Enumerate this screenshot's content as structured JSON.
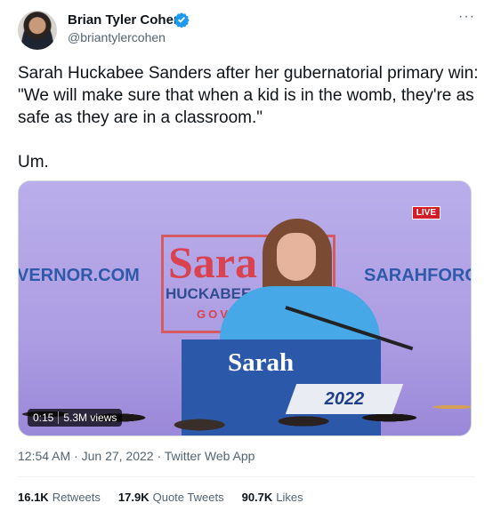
{
  "author": {
    "name": "Brian Tyler Cohen",
    "handle": "@briantylercohen",
    "verified_color": "#1d9bf0"
  },
  "icons": [
    "avatar",
    "verified-badge-icon",
    "more-options-icon"
  ],
  "more_label": "···",
  "tweet_text": "Sarah Huckabee Sanders after her gubernatorial primary win: \"We will make sure that when a kid is in the womb, they're as safe as they are in a classroom.\"\n\nUm.",
  "video": {
    "live_label": "LIVE",
    "duration": "0:15",
    "views": "5.3M views",
    "banner_left": "VERNOR.COM",
    "banner_right": "SARAHFORGO",
    "sign_name": "Sara",
    "sign_surname": "HUCKABEE",
    "sign_gov": "GOV",
    "podium_name": "Sarah",
    "year_badge": "2022"
  },
  "meta": {
    "time": "12:54 AM",
    "date": "Jun 27, 2022",
    "source": "Twitter Web App",
    "separator": "·"
  },
  "stats": {
    "retweets_count": "16.1K",
    "retweets_label": "Retweets",
    "quotes_count": "17.9K",
    "quotes_label": "Quote Tweets",
    "likes_count": "90.7K",
    "likes_label": "Likes"
  }
}
